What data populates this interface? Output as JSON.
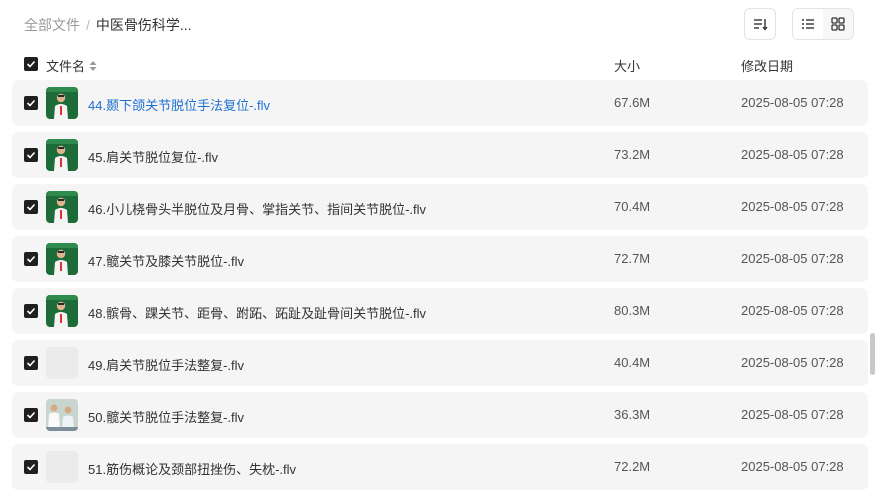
{
  "breadcrumb": {
    "root": "全部文件",
    "separator": "/",
    "current": "中医骨伤科学..."
  },
  "header": {
    "name": "文件名",
    "size": "大小",
    "modified": "修改日期"
  },
  "files": [
    {
      "name": "44.颞下颌关节脱位手法复位-.flv",
      "size": "67.6M",
      "date": "2025-08-05 07:28",
      "thumb": "video-lecture",
      "highlighted": true
    },
    {
      "name": "45.肩关节脱位复位-.flv",
      "size": "73.2M",
      "date": "2025-08-05 07:28",
      "thumb": "video-lecture",
      "highlighted": false
    },
    {
      "name": "46.小儿桡骨头半脱位及月骨、掌指关节、指间关节脱位-.flv",
      "size": "70.4M",
      "date": "2025-08-05 07:28",
      "thumb": "video-lecture",
      "highlighted": false
    },
    {
      "name": "47.髋关节及膝关节脱位-.flv",
      "size": "72.7M",
      "date": "2025-08-05 07:28",
      "thumb": "video-lecture",
      "highlighted": false
    },
    {
      "name": "48.髌骨、踝关节、距骨、跗跖、跖趾及趾骨间关节脱位-.flv",
      "size": "80.3M",
      "date": "2025-08-05 07:28",
      "thumb": "video-lecture",
      "highlighted": false
    },
    {
      "name": "49.肩关节脱位手法整复-.flv",
      "size": "40.4M",
      "date": "2025-08-05 07:28",
      "thumb": "placeholder",
      "highlighted": false
    },
    {
      "name": "50.髋关节脱位手法整复-.flv",
      "size": "36.3M",
      "date": "2025-08-05 07:28",
      "thumb": "video-clinic",
      "highlighted": false
    },
    {
      "name": "51.筋伤概论及颈部扭挫伤、失枕-.flv",
      "size": "72.2M",
      "date": "2025-08-05 07:28",
      "thumb": "placeholder",
      "highlighted": false
    }
  ]
}
